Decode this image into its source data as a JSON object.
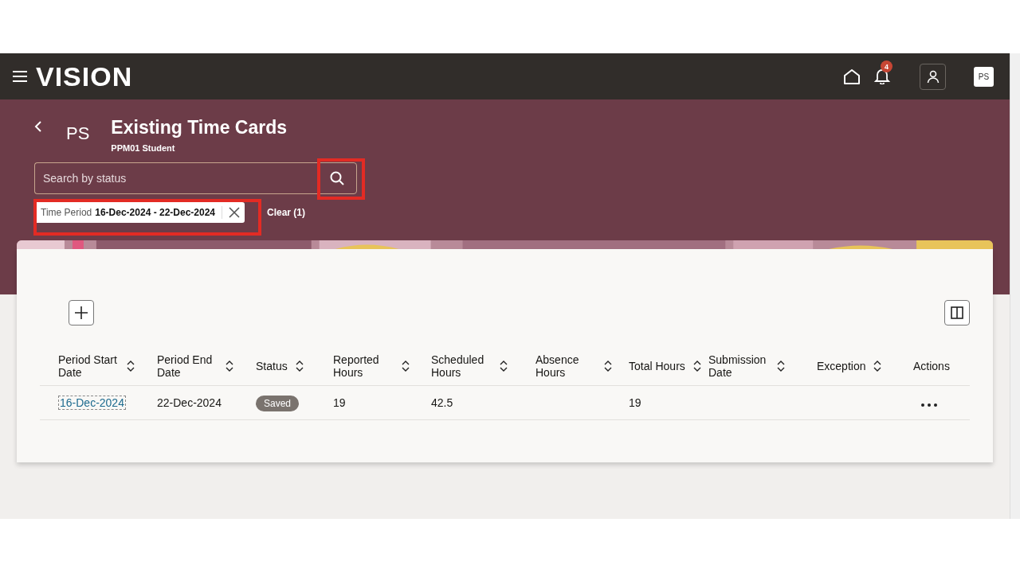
{
  "header": {
    "logo": "VISION",
    "notifications": "4",
    "avatar": "PS"
  },
  "page": {
    "initials": "PS",
    "title": "Existing Time Cards",
    "subtitle": "PPM01 Student"
  },
  "search": {
    "placeholder": "Search by status"
  },
  "filter_chip": {
    "label": "Time Period",
    "value": "16-Dec-2024 - 22-Dec-2024"
  },
  "clear": "Clear (1)",
  "table": {
    "columns": [
      {
        "label": "Period Start Date",
        "sortable": true
      },
      {
        "label": "Period End Date",
        "sortable": true
      },
      {
        "label": "Status",
        "sortable": true
      },
      {
        "label": "Reported Hours",
        "sortable": true
      },
      {
        "label": "Scheduled Hours",
        "sortable": true
      },
      {
        "label": "Absence Hours",
        "sortable": true
      },
      {
        "label": "Total Hours",
        "sortable": true
      },
      {
        "label": "Submission Date",
        "sortable": true
      },
      {
        "label": "Exception",
        "sortable": true
      },
      {
        "label": "Actions",
        "sortable": false
      }
    ],
    "rows": [
      {
        "cells": [
          {
            "kind": "link",
            "text": "16-Dec-2024"
          },
          {
            "kind": "text",
            "text": "22-Dec-2024"
          },
          {
            "kind": "badge",
            "text": "Saved"
          },
          {
            "kind": "text",
            "text": "19"
          },
          {
            "kind": "text",
            "text": "42.5"
          },
          {
            "kind": "empty"
          },
          {
            "kind": "text",
            "text": "19"
          },
          {
            "kind": "empty"
          },
          {
            "kind": "empty"
          },
          {
            "kind": "menu"
          }
        ]
      }
    ]
  }
}
